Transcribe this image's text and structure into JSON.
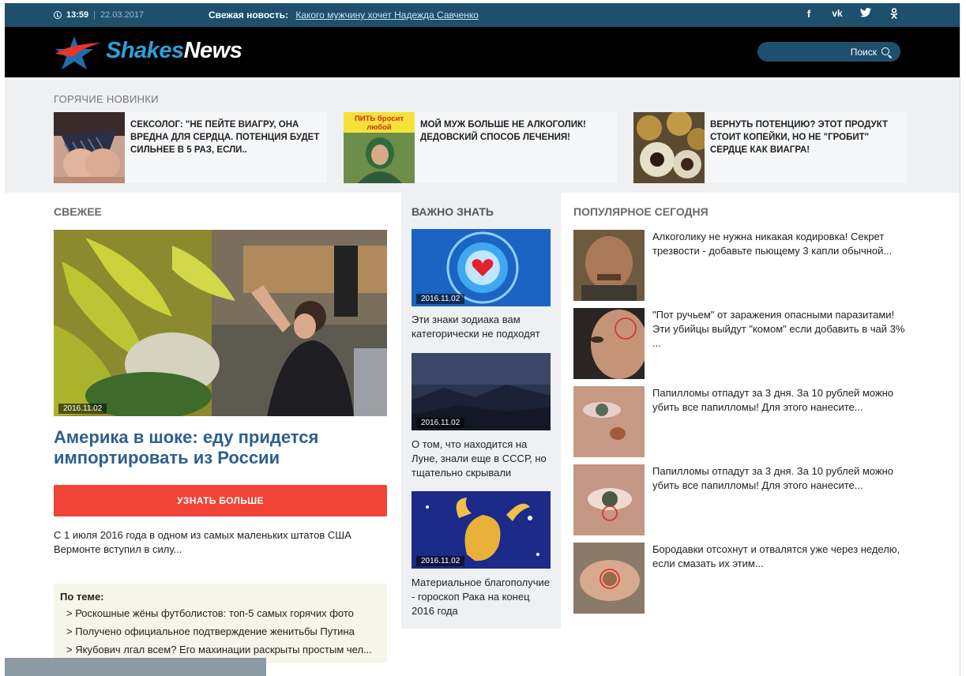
{
  "topbar": {
    "time": "13:59",
    "separator": "|",
    "date": "22.03.2017",
    "fresh_label": "Свежая новость:",
    "fresh_link": "Какого мужчину хочет Надежда Савченко",
    "social": [
      "f",
      "vk",
      "twitter",
      "ok"
    ]
  },
  "header": {
    "brand_part1": "Shakes",
    "brand_part2": "News",
    "search_label": "Поиск"
  },
  "hot": {
    "title": "ГОРЯЧИЕ НОВИНКИ",
    "items": [
      {
        "text": "СЕКСОЛОГ: \"НЕ ПЕЙТЕ ВИАГРУ, ОНА ВРЕДНА ДЛЯ СЕРДЦА. ПОТЕНЦИЯ БУДЕТ СИЛЬНЕЕ В 5 РАЗ, ЕСЛИ..",
        "image_text": ""
      },
      {
        "text": "МОЙ МУЖ БОЛЬШЕ НЕ АЛКОГОЛИК! ДЕДОВСКИЙ СПОСОБ ЛЕЧЕНИЯ!",
        "image_text": "ПИТЬ бросит любой"
      },
      {
        "text": "ВЕРНУТЬ ПОТЕНЦИЮ? ЭТОТ ПРОДУКТ СТОИТ КОПЕЙКИ, НО НЕ \"ГРОБИТ\" СЕРДЦЕ КАК ВИАГРА!",
        "image_text": ""
      }
    ]
  },
  "fresh": {
    "title": "СВЕЖЕЕ",
    "date": "2016.11.02",
    "headline": "Америка в шоке: еду придется импортировать из России",
    "button": "УЗНАТЬ БОЛЬШЕ",
    "lead": "С 1 июля 2016 года в одном из самых маленьких штатов США Вермонте вступил в силу...",
    "related_title": "По теме:",
    "related": [
      "> Роскошные жёны футболистов: топ-5 самых горячих фото",
      "> Получено официальное подтверждение женитьбы Путина",
      "> Якубович лгал всем? Его махинации раскрыты простым чел..."
    ]
  },
  "important": {
    "title": "ВАЖНО ЗНАТЬ",
    "items": [
      {
        "date": "2016.11.02",
        "caption": "Эти знаки зодиака вам категорически не подходят"
      },
      {
        "date": "2016.11.02",
        "caption": "О том, что находится на Луне, знали еще в СССР, но тщательно скрывали"
      },
      {
        "date": "2016.11.02",
        "caption": "Материальное благополучие - гороскоп Рака на конец 2016 года"
      }
    ]
  },
  "popular": {
    "title": "ПОПУЛЯРНОЕ СЕГОДНЯ",
    "items": [
      {
        "text": "Алкоголику не нужна никакая кодировка! Секрет трезвости - добавьте пьющему 3 капли обычной..."
      },
      {
        "text": "\"Пот ручьем\" от заражения опасными паразитами! Эти убийцы выйдут \"комом\" если добавить в чай 3% ..."
      },
      {
        "text": "Папилломы отпадут за 3 дня. За 10 рублей можно убить все папилломы! Для этого нанесите..."
      },
      {
        "text": "Папилломы отпадут за 3 дня. За 10 рублей можно убить все папилломы! Для этого нанесите..."
      },
      {
        "text": "Бородавки отсохнут и отвалятся уже через неделю, если смазать их этим..."
      }
    ]
  },
  "colors": {
    "topbar": "#1e4f6d",
    "header": "#000000",
    "brand_blue": "#2f9fd8",
    "headline_blue": "#2c5f8f",
    "button_red": "#f04335"
  }
}
